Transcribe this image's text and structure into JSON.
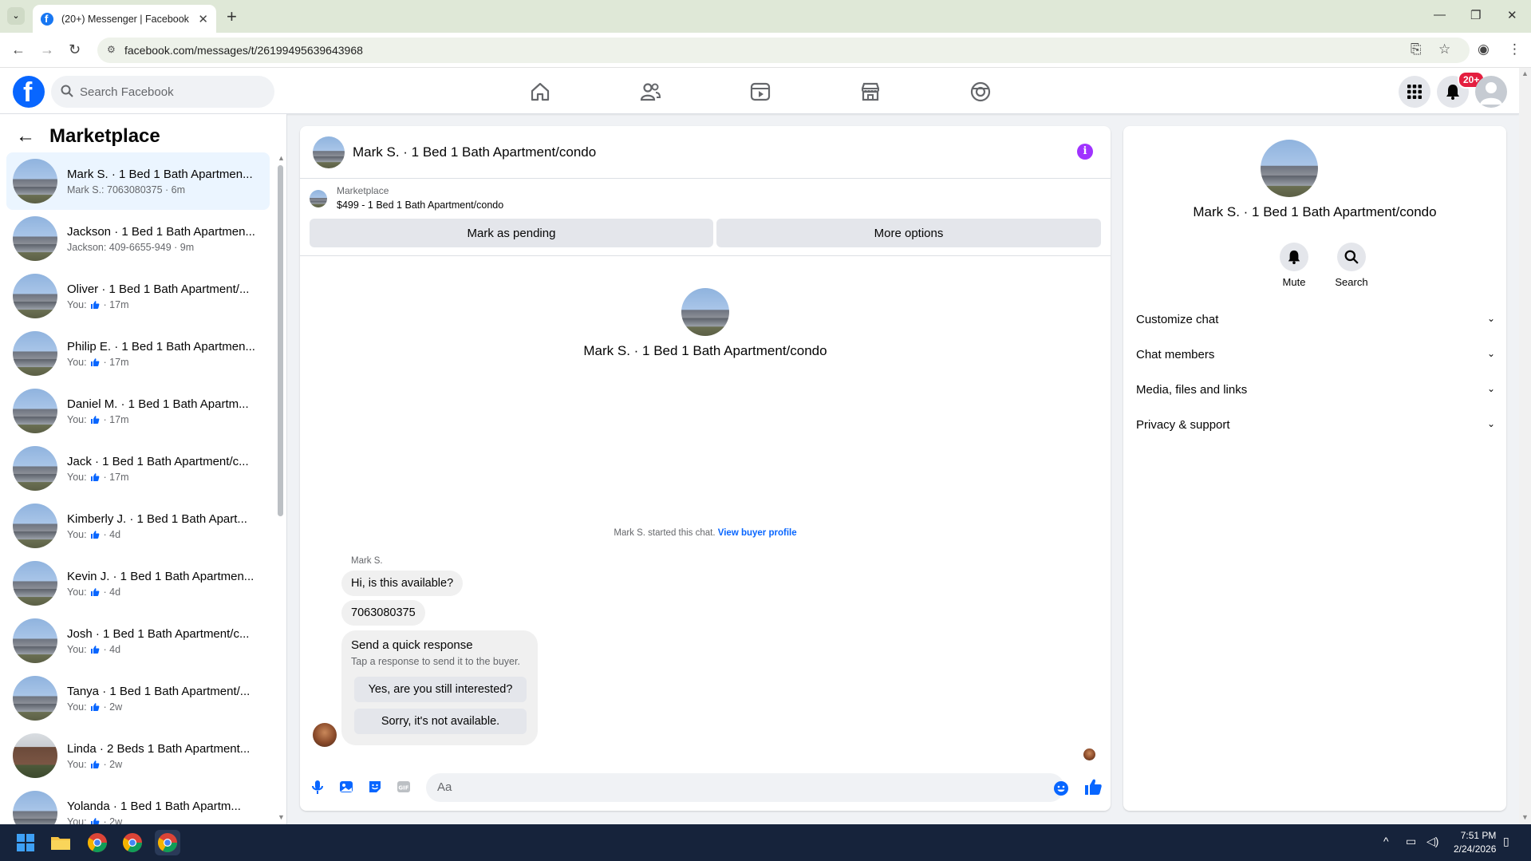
{
  "browser": {
    "tab_title": "(20+) Messenger | Facebook",
    "url": "facebook.com/messages/t/26199495639643968"
  },
  "fb_nav": {
    "search_placeholder": "Search Facebook",
    "notification_badge": "20+"
  },
  "sidebar": {
    "title": "Marketplace",
    "conversations": [
      {
        "name": "Mark S. · 1 Bed 1 Bath Apartmen...",
        "sub": "Mark S.: 7063080375 · 6m",
        "avatar": "building",
        "active": true
      },
      {
        "name": "Jackson · 1 Bed 1 Bath Apartmen...",
        "sub": "Jackson: 409-6655-949 · 9m",
        "avatar": "building"
      },
      {
        "name": "Oliver · 1 Bed 1 Bath Apartment/...",
        "sub_prefix": "You:",
        "sub_time": "· 17m",
        "avatar": "building"
      },
      {
        "name": "Philip E. · 1 Bed 1 Bath Apartmen...",
        "sub_prefix": "You:",
        "sub_time": "· 17m",
        "avatar": "building"
      },
      {
        "name": "Daniel M. · 1 Bed 1 Bath Apartm...",
        "sub_prefix": "You:",
        "sub_time": "· 17m",
        "avatar": "building"
      },
      {
        "name": "Jack · 1 Bed 1 Bath Apartment/c...",
        "sub_prefix": "You:",
        "sub_time": "· 17m",
        "avatar": "building"
      },
      {
        "name": "Kimberly J. · 1 Bed 1 Bath Apart...",
        "sub_prefix": "You:",
        "sub_time": "· 4d",
        "avatar": "building"
      },
      {
        "name": "Kevin J. · 1 Bed 1 Bath Apartmen...",
        "sub_prefix": "You:",
        "sub_time": "· 4d",
        "avatar": "building"
      },
      {
        "name": "Josh · 1 Bed 1 Bath Apartment/c...",
        "sub_prefix": "You:",
        "sub_time": "· 4d",
        "avatar": "building"
      },
      {
        "name": "Tanya · 1 Bed 1 Bath Apartment/...",
        "sub_prefix": "You:",
        "sub_time": "· 2w",
        "avatar": "building"
      },
      {
        "name": "Linda · 2 Beds 1 Bath Apartment...",
        "sub_prefix": "You:",
        "sub_time": "· 2w",
        "avatar": "brick"
      },
      {
        "name": "Yolanda · 1 Bed 1 Bath Apartm...",
        "sub_prefix": "You:",
        "sub_time": "· 2w",
        "avatar": "building"
      }
    ]
  },
  "chat": {
    "title": "Mark S. · 1 Bed 1 Bath Apartment/condo",
    "listing_source": "Marketplace",
    "listing_desc": "$499 - 1 Bed 1 Bath Apartment/condo",
    "mark_pending": "Mark as pending",
    "more_options": "More options",
    "intro_name": "Mark S. · 1 Bed 1 Bath Apartment/condo",
    "started_text": "Mark S. started this chat.",
    "view_buyer": "View buyer profile",
    "sender": "Mark S.",
    "messages": [
      "Hi, is this available?",
      "7063080375"
    ],
    "quick_title": "Send a quick response",
    "quick_sub": "Tap a response to send it to the buyer.",
    "quick_1": "Yes, are you still interested?",
    "quick_2": "Sorry, it's not available.",
    "input_placeholder": "Aa"
  },
  "details": {
    "name": "Mark S. · 1 Bed 1 Bath Apartment/condo",
    "mute": "Mute",
    "search": "Search",
    "sections": [
      "Customize chat",
      "Chat members",
      "Media, files and links",
      "Privacy & support"
    ]
  },
  "taskbar": {
    "time": "7:51 PM",
    "date": "2/24/2026"
  }
}
